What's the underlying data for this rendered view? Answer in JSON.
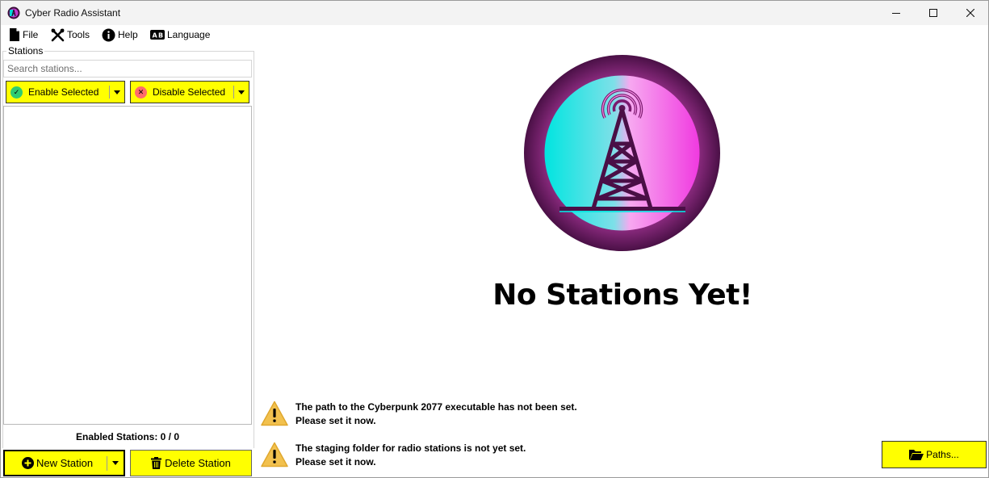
{
  "window": {
    "title": "Cyber Radio Assistant"
  },
  "menu": {
    "items": [
      {
        "label": "File",
        "icon": "file-icon"
      },
      {
        "label": "Tools",
        "icon": "tools-icon"
      },
      {
        "label": "Help",
        "icon": "info-icon"
      },
      {
        "label": "Language",
        "icon": "language-icon"
      }
    ]
  },
  "sidebar": {
    "group_label": "Stations",
    "search_placeholder": "Search stations...",
    "enable_label": "Enable Selected",
    "disable_label": "Disable Selected",
    "stations": [],
    "enabled_count_text": "Enabled Stations: 0 / 0",
    "new_station_label": "New Station",
    "delete_station_label": "Delete Station"
  },
  "main": {
    "empty_title": "No Stations Yet!",
    "warnings": [
      {
        "line1": "The path to the Cyberpunk 2077 executable has not been set.",
        "line2": "Please set it now."
      },
      {
        "line1": "The staging folder for radio stations is not yet set.",
        "line2": "Please set it now."
      }
    ],
    "paths_label": "Paths..."
  },
  "colors": {
    "accent": "#ffff00",
    "enable_icon": "#2ecc71",
    "disable_icon": "#ff6b6b",
    "warning": "#f2c14e",
    "logo_cyan": "#00e5e0",
    "logo_magenta": "#f03ae0",
    "logo_purple": "#5a1452"
  }
}
